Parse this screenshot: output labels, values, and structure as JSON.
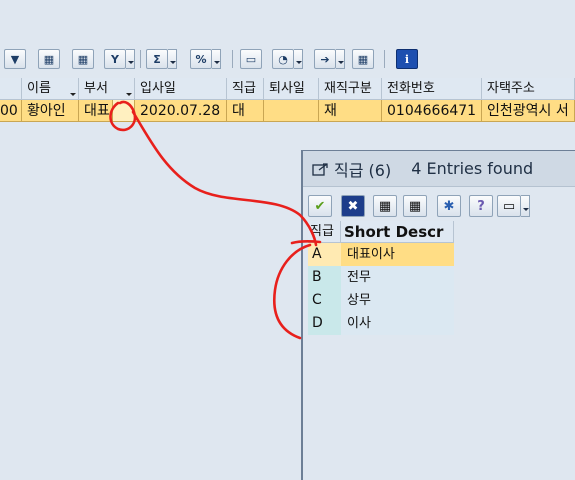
{
  "toolbar": {
    "buttons": [
      {
        "name": "filter-funnel-icon",
        "glyph": "▼"
      },
      {
        "name": "find-icon",
        "glyph": "▦"
      },
      {
        "name": "find-next-icon",
        "glyph": "▦"
      },
      {
        "name": "set-filter-icon",
        "glyph": "Y"
      },
      {
        "name": "sum-icon",
        "glyph": "Σ"
      },
      {
        "name": "subtotal-icon",
        "glyph": "%"
      },
      {
        "name": "print-icon",
        "glyph": "▭"
      },
      {
        "name": "change-layout-icon",
        "glyph": "◔"
      },
      {
        "name": "export-icon",
        "glyph": "➔"
      },
      {
        "name": "grid-layout-icon",
        "glyph": "▦"
      },
      {
        "name": "info-icon",
        "glyph": "i"
      }
    ]
  },
  "grid": {
    "columns": [
      "",
      "이름",
      "부서",
      "입사일",
      "직급",
      "퇴사일",
      "재직구분",
      "전화번호",
      "자택주소"
    ],
    "rows": [
      [
        "00",
        "황아인",
        "대표",
        "",
        "2020.07.28",
        "대",
        "",
        "재",
        "0104666471",
        "인천광역시 서"
      ]
    ]
  },
  "popup": {
    "title": "직급 (6)",
    "entries_found": "4 Entries found",
    "toolbar": [
      {
        "name": "confirm-check-icon",
        "glyph": "✔"
      },
      {
        "name": "cancel-x-icon",
        "glyph": "✖"
      },
      {
        "name": "find-icon",
        "glyph": "▦"
      },
      {
        "name": "find-next-icon",
        "glyph": "▦"
      },
      {
        "name": "new-restriction-icon",
        "glyph": "✱"
      },
      {
        "name": "help-icon",
        "glyph": "?"
      },
      {
        "name": "print-icon",
        "glyph": "▭"
      }
    ],
    "columns": [
      "직급",
      "Short Descr"
    ],
    "rows": [
      {
        "key": "A",
        "text": "대표이사"
      },
      {
        "key": "B",
        "text": "전무"
      },
      {
        "key": "C",
        "text": "상무"
      },
      {
        "key": "D",
        "text": "이사"
      }
    ]
  },
  "colors": {
    "selected_row": "#ffdd85",
    "annotation": "#e8201c"
  }
}
